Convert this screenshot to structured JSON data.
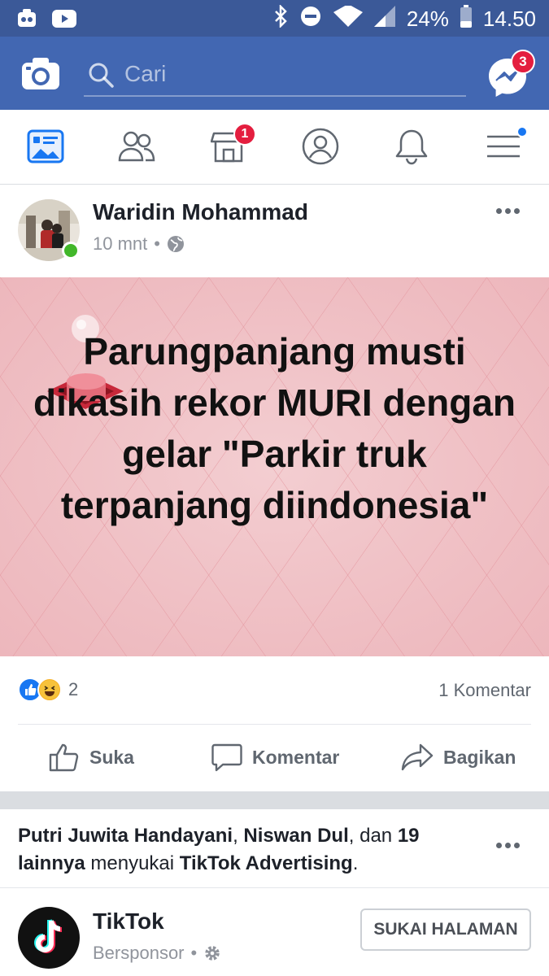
{
  "status_bar": {
    "battery": "24%",
    "time": "14.50"
  },
  "app_bar": {
    "search_placeholder": "Cari",
    "messenger_badge": "3"
  },
  "nav": {
    "marketplace_badge": "1"
  },
  "post": {
    "author": "Waridin Mohammad",
    "time": "10 mnt",
    "text": "Parungpanjang musti dikasih rekor MURI dengan gelar \"Parkir truk terpanjang diindonesia\"",
    "reaction_count": "2",
    "comment_count": "1 Komentar",
    "actions": {
      "like": "Suka",
      "comment": "Komentar",
      "share": "Bagikan"
    },
    "background_color": "#f1c5c9"
  },
  "sponsored": {
    "context_name1": "Putri Juwita Handayani",
    "context_sep": ",",
    "context_name2": "Niswan Dul",
    "context_and": ", dan",
    "context_others": "19 lainnya",
    "context_likes": "menyukai",
    "context_page": "TikTok Advertising",
    "context_end": ".",
    "page_name": "TikTok",
    "label": "Bersponsor",
    "like_page_button": "SUKAI HALAMAN"
  },
  "colors": {
    "brand": "#4267b2",
    "status_bar": "#3b5998",
    "badge": "#e41e3f"
  }
}
